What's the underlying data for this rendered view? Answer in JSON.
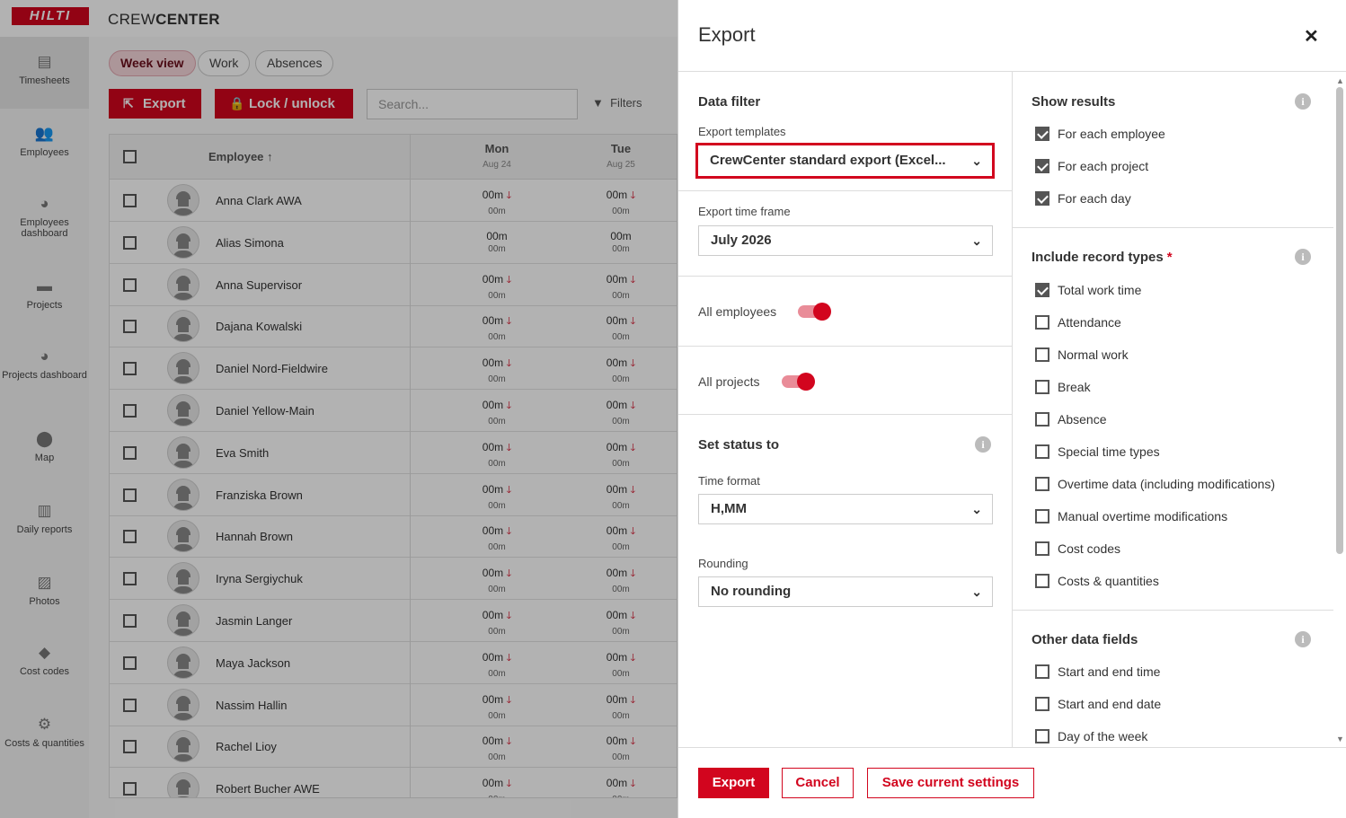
{
  "app": {
    "logo": "HILTI",
    "title_light": "CREW",
    "title_bold": "CENTER"
  },
  "sidebar": {
    "items": [
      {
        "label": "Timesheets",
        "icon": "document-icon",
        "glyph": "▤"
      },
      {
        "label": "Employees",
        "icon": "people-icon",
        "glyph": "👥"
      },
      {
        "label": "Employees dashboard",
        "icon": "pie-chart-icon",
        "glyph": "◕"
      },
      {
        "label": "Projects",
        "icon": "briefcase-icon",
        "glyph": "▬"
      },
      {
        "label": "Projects dashboard",
        "icon": "pie-chart-icon",
        "glyph": "◕"
      },
      {
        "label": "Map",
        "icon": "map-pin-icon",
        "glyph": "⬤"
      },
      {
        "label": "Daily reports",
        "icon": "book-icon",
        "glyph": "▥"
      },
      {
        "label": "Photos",
        "icon": "image-icon",
        "glyph": "▨"
      },
      {
        "label": "Cost codes",
        "icon": "tag-icon",
        "glyph": "◆"
      },
      {
        "label": "Costs & quantities",
        "icon": "cost-icon",
        "glyph": "⚙"
      }
    ]
  },
  "tabs": [
    "Week view",
    "Work",
    "Absences"
  ],
  "toolbar": {
    "export_label": "Export",
    "lock_label": "Lock / unlock",
    "search_placeholder": "Search...",
    "filters_label": "Filters"
  },
  "table": {
    "employee_header": "Employee ↑",
    "days": [
      {
        "name": "Mon",
        "date": "Aug 24"
      },
      {
        "name": "Tue",
        "date": "Aug 25"
      }
    ],
    "rows": [
      {
        "name": "Anna Clark AWA",
        "mon": "00m",
        "mon_sub": "00m",
        "mon_down": true,
        "tue": "00m",
        "tue_sub": "00m",
        "tue_down": true
      },
      {
        "name": "Alias Simona",
        "mon": "00m",
        "mon_sub": "00m",
        "mon_down": false,
        "tue": "00m",
        "tue_sub": "00m",
        "tue_down": false
      },
      {
        "name": "Anna Supervisor",
        "mon": "00m",
        "mon_sub": "00m",
        "mon_down": true,
        "tue": "00m",
        "tue_sub": "00m",
        "tue_down": true
      },
      {
        "name": "Dajana Kowalski",
        "mon": "00m",
        "mon_sub": "00m",
        "mon_down": true,
        "tue": "00m",
        "tue_sub": "00m",
        "tue_down": true
      },
      {
        "name": "Daniel Nord-Fieldwire",
        "mon": "00m",
        "mon_sub": "00m",
        "mon_down": true,
        "tue": "00m",
        "tue_sub": "00m",
        "tue_down": true
      },
      {
        "name": "Daniel Yellow-Main",
        "mon": "00m",
        "mon_sub": "00m",
        "mon_down": true,
        "tue": "00m",
        "tue_sub": "00m",
        "tue_down": true
      },
      {
        "name": "Eva Smith",
        "mon": "00m",
        "mon_sub": "00m",
        "mon_down": true,
        "tue": "00m",
        "tue_sub": "00m",
        "tue_down": true
      },
      {
        "name": "Franziska Brown",
        "mon": "00m",
        "mon_sub": "00m",
        "mon_down": true,
        "tue": "00m",
        "tue_sub": "00m",
        "tue_down": true
      },
      {
        "name": "Hannah Brown",
        "mon": "00m",
        "mon_sub": "00m",
        "mon_down": true,
        "tue": "00m",
        "tue_sub": "00m",
        "tue_down": true
      },
      {
        "name": "Iryna Sergiychuk",
        "mon": "00m",
        "mon_sub": "00m",
        "mon_down": true,
        "tue": "00m",
        "tue_sub": "00m",
        "tue_down": true
      },
      {
        "name": "Jasmin Langer",
        "mon": "00m",
        "mon_sub": "00m",
        "mon_down": true,
        "tue": "00m",
        "tue_sub": "00m",
        "tue_down": true
      },
      {
        "name": "Maya Jackson",
        "mon": "00m",
        "mon_sub": "00m",
        "mon_down": true,
        "tue": "00m",
        "tue_sub": "00m",
        "tue_down": true
      },
      {
        "name": "Nassim Hallin",
        "mon": "00m",
        "mon_sub": "00m",
        "mon_down": true,
        "tue": "00m",
        "tue_sub": "00m",
        "tue_down": true
      },
      {
        "name": "Rachel Lioy",
        "mon": "00m",
        "mon_sub": "00m",
        "mon_down": true,
        "tue": "00m",
        "tue_sub": "00m",
        "tue_down": true
      },
      {
        "name": "Robert Bucher AWE",
        "mon": "00m",
        "mon_sub": "00m",
        "mon_down": true,
        "tue": "00m",
        "tue_sub": "00m",
        "tue_down": true
      }
    ]
  },
  "export_panel": {
    "title": "Export",
    "close_glyph": "✕",
    "data_filter": {
      "heading": "Data filter",
      "templates_label": "Export templates",
      "templates_value": "CrewCenter standard export (Excel...",
      "timeframe_label": "Export time frame",
      "timeframe_value": "July 2026",
      "all_employees_label": "All employees",
      "all_employees_on": true,
      "all_projects_label": "All projects",
      "all_projects_on": true
    },
    "set_status": {
      "heading": "Set status to",
      "time_format_label": "Time format",
      "time_format_value": "H,MM",
      "rounding_label": "Rounding",
      "rounding_value": "No rounding"
    },
    "show_results": {
      "heading": "Show results",
      "options": [
        {
          "label": "For each employee",
          "checked": true
        },
        {
          "label": "For each project",
          "checked": true
        },
        {
          "label": "For each day",
          "checked": true
        }
      ]
    },
    "record_types": {
      "heading": "Include record types",
      "required_mark": "*",
      "options": [
        {
          "label": "Total work time",
          "checked": true
        },
        {
          "label": "Attendance",
          "checked": false
        },
        {
          "label": "Normal work",
          "checked": false
        },
        {
          "label": "Break",
          "checked": false
        },
        {
          "label": "Absence",
          "checked": false
        },
        {
          "label": "Special time types",
          "checked": false
        },
        {
          "label": "Overtime data (including modifications)",
          "checked": false
        },
        {
          "label": "Manual overtime modifications",
          "checked": false
        },
        {
          "label": "Cost codes",
          "checked": false
        },
        {
          "label": "Costs & quantities",
          "checked": false
        }
      ]
    },
    "other_fields": {
      "heading": "Other data fields",
      "options": [
        {
          "label": "Start and end time",
          "checked": false
        },
        {
          "label": "Start and end date",
          "checked": false
        },
        {
          "label": "Day of the week",
          "checked": false
        }
      ]
    },
    "footer": {
      "export_label": "Export",
      "cancel_label": "Cancel",
      "save_label": "Save current settings"
    }
  },
  "colors": {
    "brand": "#d2051e",
    "toggle_track": "#e98c98"
  }
}
